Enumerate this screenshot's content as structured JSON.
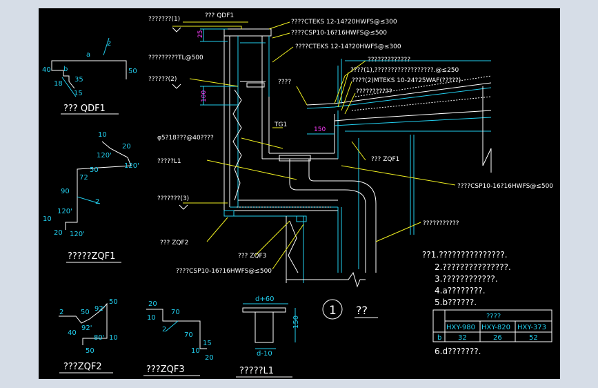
{
  "labels": {
    "qdf1_top": "??? QDF1",
    "l1_mark": "???????(1)",
    "cteks_1": "????CTEKS 12-14?20HWFS@≤300",
    "csp_1": "????CSP10-16?16HWFS@≤500",
    "cteks_2": "????CTEKS 12-14?20HWFS@≤300",
    "tl500": "?????????TL@500",
    "top_note": "?????????????",
    "sheet_note_1": "????(1),??????????????????.@≤250",
    "sheet_note_2": "????(2)MTEKS 10-24?25WAF(?????)",
    "insul_note": "???????????",
    "mark_2": "??????(2)",
    "left_note": "????",
    "tg1": "TG1",
    "dim150": "150",
    "zqf1": "??? ZQF1",
    "bolt_note": "φ5?18???@40????",
    "l1_label": "?????L1",
    "csp_2": "????CSP10-16?16HWFS@≤500",
    "mark_3": "???????(3)",
    "wall_note": "???????????",
    "zqf2": "??? ZQF2",
    "zqf3": "??? ZQF3",
    "csp_3": "????CSP10-16?16HWFS@≤500",
    "dim25": "25",
    "dim100": "100"
  },
  "notes": [
    "??1.???????????????.",
    "2.???????????????.",
    "3.????????????.",
    "4.a????????.",
    "5.b??????."
  ],
  "note6": "6.d???????.",
  "table": {
    "title": "????",
    "headers": [
      "HXY-980",
      "HXY-820",
      "HXY-373"
    ],
    "row_label": "b",
    "row": [
      "32",
      "26",
      "52"
    ]
  },
  "detail": {
    "number": "1",
    "title": "??"
  },
  "profiles": {
    "qdf1": {
      "title": "??? QDF1",
      "a": "a",
      "d2": "2",
      "d40": "40",
      "db": "b",
      "d35": "35",
      "d50": "50",
      "d18": "18",
      "d15": "15"
    },
    "zqf1": {
      "title": "?????ZQF1",
      "d10a": "10",
      "d20a": "20",
      "a120a": "120'",
      "a120b": "120'",
      "d50": "50",
      "d72": "72",
      "d90": "90",
      "d2": "2",
      "a120c": "120'",
      "d10b": "10",
      "d20b": "20",
      "a120d": "120'"
    },
    "zqf2": {
      "title": "???ZQF2",
      "d2": "2",
      "d50a": "50",
      "a92a": "92'",
      "d50b": "50",
      "d40": "40",
      "a92b": "92'",
      "a80": "80'",
      "d10": "10",
      "d50c": "50"
    },
    "zqf3": {
      "title": "???ZQF3",
      "d20a": "20",
      "d70a": "70",
      "d10a": "10",
      "d2": "2",
      "d70b": "70",
      "d15": "15",
      "d10b": "10",
      "d20b": "20"
    },
    "l1": {
      "title": "?????L1",
      "d60": "d+60",
      "d150": "150",
      "d10": "d-10"
    }
  }
}
